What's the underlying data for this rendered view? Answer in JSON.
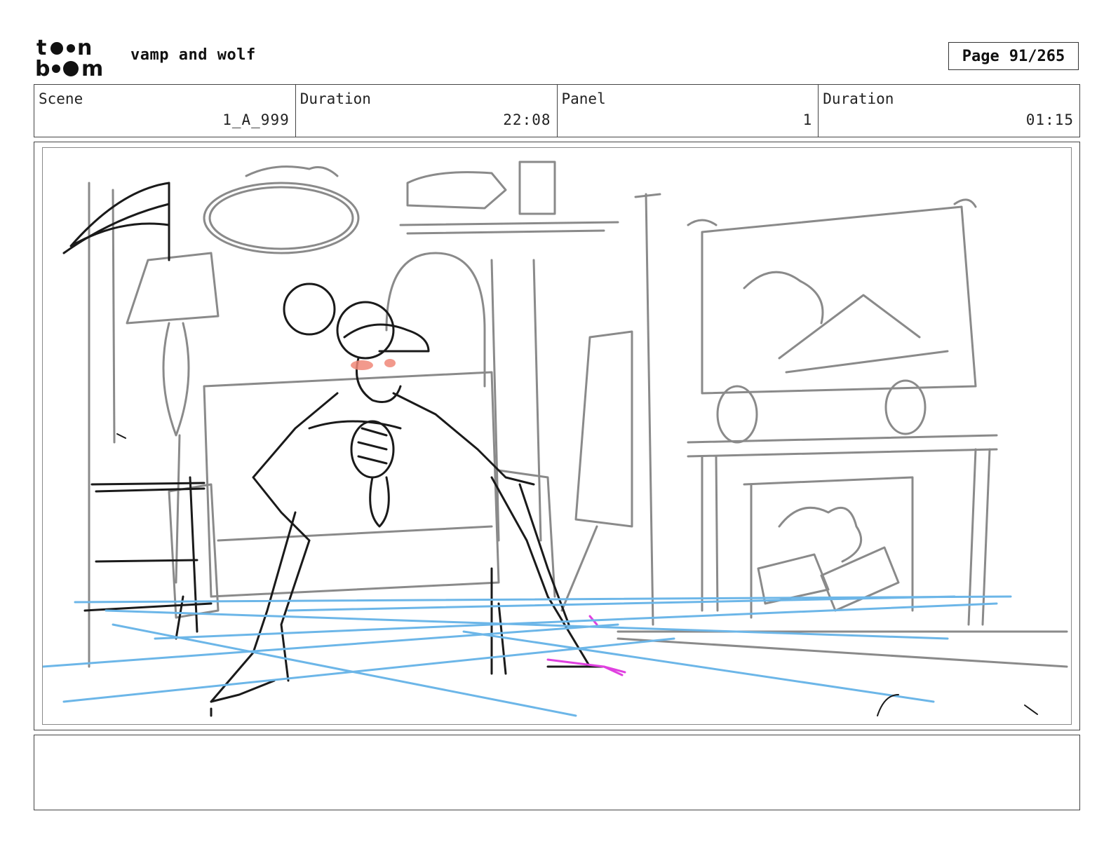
{
  "header": {
    "logo": {
      "icon": "toonboom-logo",
      "line1": "toon",
      "line2": "boom"
    },
    "project_title": "vamp and wolf",
    "page_label": "Page",
    "page_value": "91/265"
  },
  "info": {
    "scene_label": "Scene",
    "scene_value": "1_A_999",
    "scene_duration_label": "Duration",
    "scene_duration_value": "22:08",
    "panel_label": "Panel",
    "panel_value": "1",
    "panel_duration_label": "Duration",
    "panel_duration_value": "01:15"
  },
  "panel_sketch": {
    "icon": "storyboard-sketch-image",
    "colors": {
      "gray": "#8a8a8a",
      "ink": "#1a1a1a",
      "blue": "#6cb6e8",
      "magenta": "#e040e0",
      "blush": "#f08878"
    }
  },
  "notes": {
    "text": ""
  }
}
